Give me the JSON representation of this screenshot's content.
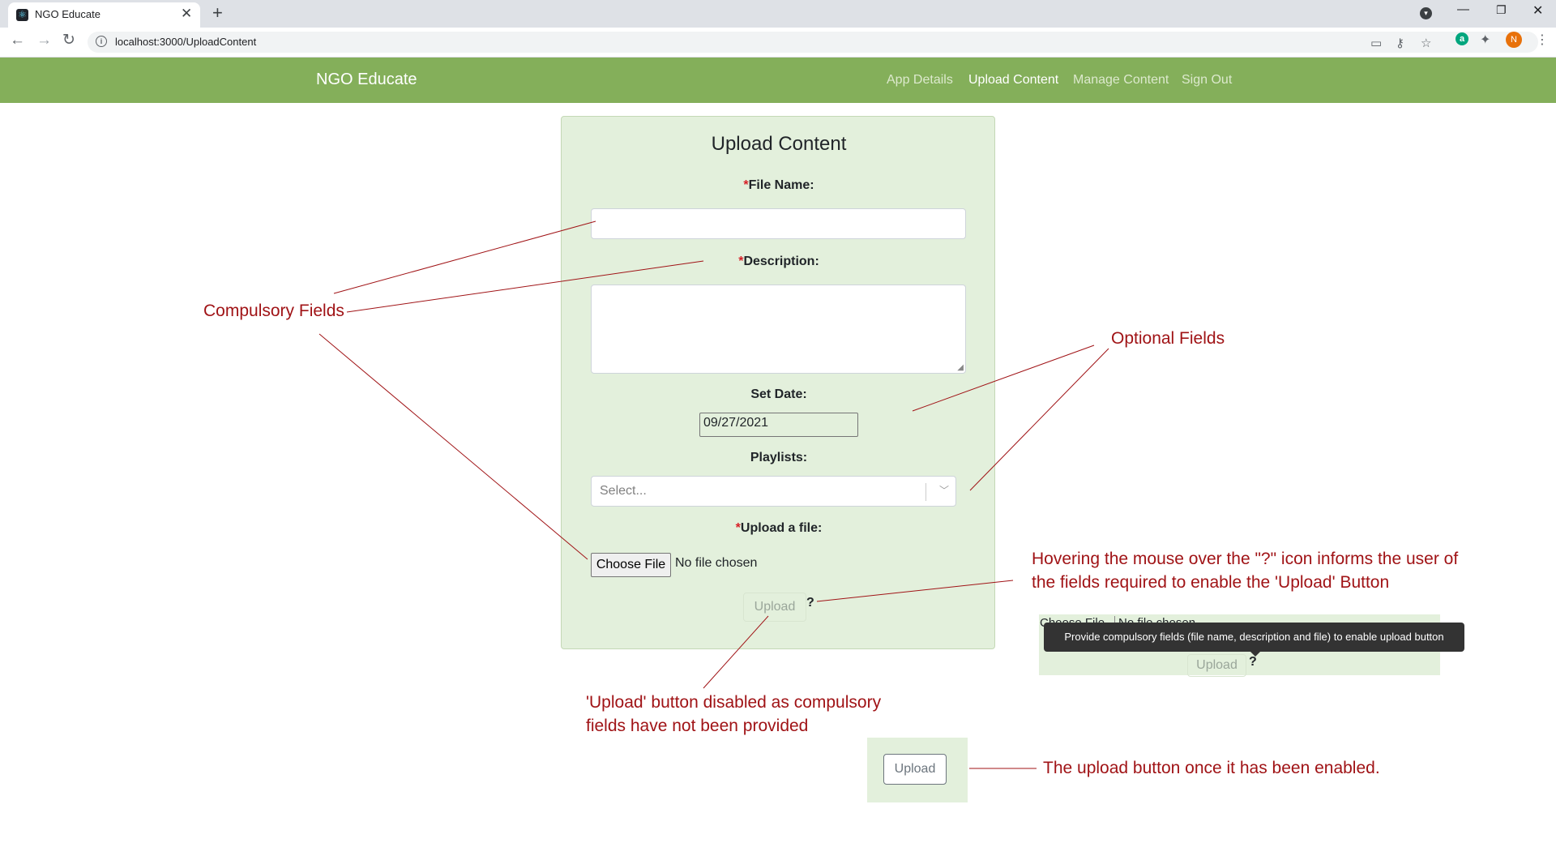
{
  "browser": {
    "tab_title": "NGO Educate",
    "tab_close": "✕",
    "new_tab": "+",
    "url": "localhost:3000/UploadContent",
    "avatar_initial": "N",
    "ext_letter": "a"
  },
  "navbar": {
    "brand": "NGO Educate",
    "links": [
      "App Details",
      "Upload Content",
      "Manage Content",
      "Sign Out"
    ],
    "active": "Upload Content",
    "color": "#84af5a"
  },
  "form": {
    "title": "Upload Content",
    "required_mark": "*",
    "file_name_label": "File Name:",
    "description_label": "Description:",
    "date_label": "Set Date:",
    "date_value": "09/27/2021",
    "playlists_label": "Playlists:",
    "playlists_placeholder": "Select...",
    "upload_file_label": "Upload a file:",
    "choose_file": "Choose File",
    "no_file": "No file chosen",
    "upload_button": "Upload",
    "help": "?",
    "card_color": "#e3f0dc"
  },
  "annotations": {
    "compulsory": "Compulsory Fields",
    "optional": "Optional Fields",
    "hover_line1": "Hovering the mouse over the \"?\" icon informs the user of",
    "hover_line2": "the fields required to enable the 'Upload' Button",
    "disabled_line1": "'Upload' button disabled as compulsory",
    "disabled_line2": "fields have not been provided",
    "enabled": "The upload button once it has been enabled.",
    "color": "#a01316"
  },
  "tooltip_demo": {
    "choose_file": "Choose File",
    "no_file": "No file chosen",
    "tooltip": "Provide compulsory fields (file name, description and file) to enable upload button",
    "upload": "Upload",
    "help": "?"
  },
  "enabled_demo": {
    "upload": "Upload"
  }
}
